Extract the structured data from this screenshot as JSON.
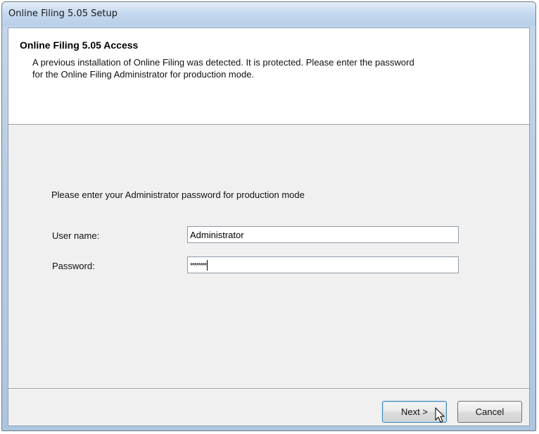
{
  "window": {
    "title": "Online Filing 5.05 Setup"
  },
  "banner": {
    "title": "Online Filing 5.05 Access",
    "description": "A previous installation of Online Filing was detected. It is protected. Please enter the password for the Online Filing Administrator for production mode."
  },
  "form": {
    "prompt": "Please enter your Administrator password for production mode",
    "username_label": "User name:",
    "username_value": "Administrator",
    "password_label": "Password:",
    "password_mask": "********"
  },
  "buttons": {
    "next": "Next >",
    "cancel": "Cancel"
  },
  "icons": {
    "pointer": "mouse-pointer-icon"
  }
}
